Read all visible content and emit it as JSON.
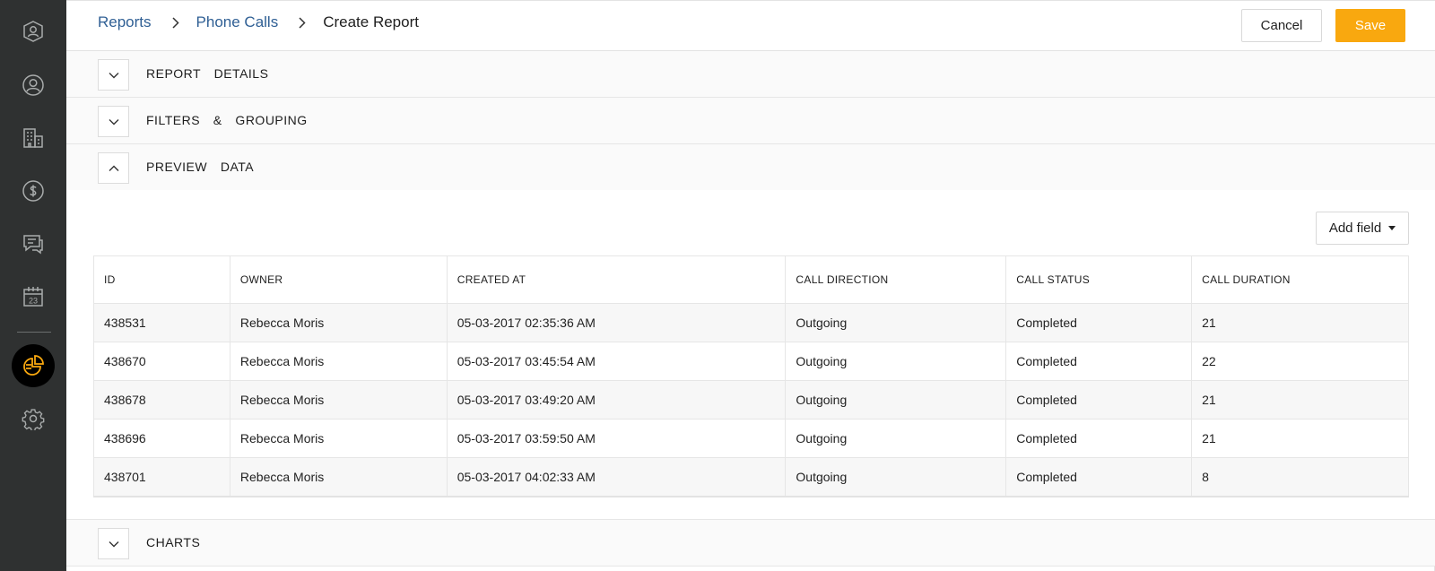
{
  "sidebar": {
    "items": [
      {
        "icon": "user-shield-icon"
      },
      {
        "icon": "user-icon"
      },
      {
        "icon": "building-icon"
      },
      {
        "icon": "dollar-icon"
      },
      {
        "icon": "chat-icon"
      },
      {
        "icon": "calendar-icon",
        "label": "23"
      },
      {
        "icon": "reports-pie-icon",
        "active": true
      },
      {
        "icon": "gear-icon"
      }
    ],
    "accent": "#f9a80f"
  },
  "breadcrumb": {
    "items": [
      "Reports",
      "Phone Calls"
    ],
    "current": "Create Report"
  },
  "actions": {
    "cancel": "Cancel",
    "save": "Save"
  },
  "sections": {
    "report_details": "REPORT  DETAILS",
    "filters_grouping": "FILTERS  &  GROUPING",
    "preview_data": "PREVIEW  DATA",
    "charts": "CHARTS"
  },
  "preview": {
    "add_field": "Add field",
    "columns": [
      "ID",
      "OWNER",
      "CREATED AT",
      "CALL DIRECTION",
      "CALL STATUS",
      "CALL DURATION"
    ],
    "rows": [
      [
        "438531",
        "Rebecca Moris",
        "05-03-2017 02:35:36 AM",
        "Outgoing",
        "Completed",
        "21"
      ],
      [
        "438670",
        "Rebecca Moris",
        "05-03-2017 03:45:54 AM",
        "Outgoing",
        "Completed",
        "22"
      ],
      [
        "438678",
        "Rebecca Moris",
        "05-03-2017 03:49:20 AM",
        "Outgoing",
        "Completed",
        "21"
      ],
      [
        "438696",
        "Rebecca Moris",
        "05-03-2017 03:59:50 AM",
        "Outgoing",
        "Completed",
        "21"
      ],
      [
        "438701",
        "Rebecca Moris",
        "05-03-2017 04:02:33 AM",
        "Outgoing",
        "Completed",
        "8"
      ]
    ]
  }
}
